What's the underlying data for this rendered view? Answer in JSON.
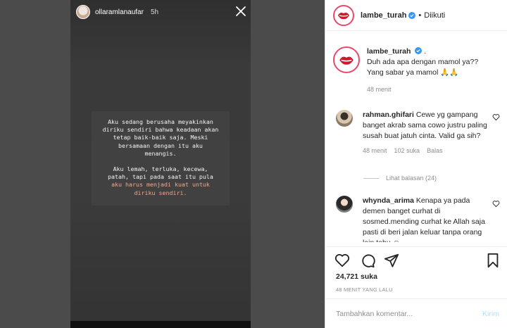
{
  "story": {
    "username": "ollaramlanaufar",
    "time": "5h",
    "text_lines": [
      "Aku sedang berusaha meyakinkan",
      "diriku sendiri bahwa keadaan akan",
      "tetap baik-baik saja. Meski",
      "bersamaan dengan itu aku",
      "menangis."
    ],
    "text_lines_2": [
      "Aku lemah, terluka, kecewa,",
      "patah, tapi pada saat itu pula"
    ],
    "highlight_lines": [
      "aku harus menjadi kuat untuk",
      "diriku sendiri."
    ],
    "highlight_color": "#f0a88e"
  },
  "post": {
    "header": {
      "username": "lambe_turah",
      "separator": "•",
      "follow_status": "Diikuti"
    },
    "caption": {
      "username": "lambe_turah",
      "suffix": ".",
      "line1": "Duh ada apa dengan mamol ya??",
      "line2": "Yang sabar ya mamol 🙏🙏",
      "time": "48 menit"
    },
    "comments": [
      {
        "username": "rahman.ghifari",
        "text": "Cewe yg gampang banget akrab sama cowo justru paling susah buat jatuh cinta. Valid ga sih?",
        "time": "48 menit",
        "likes": "102 suka",
        "reply": "Balas",
        "view_replies": "Lihat balasan (24)"
      },
      {
        "username": "whynda_arima",
        "text": "Kenapa ya pada demen banget curhat di sosmed.mending curhat ke Allah saja pasti di beri jalan keluar tanpa orang lain tahu ☺"
      }
    ],
    "likes": "24,721 suka",
    "posted_ago": "48 MENIT YANG LALU",
    "comment_placeholder": "Tambahkan komentar...",
    "post_button": "Kirim",
    "colors": {
      "brand_ring": "#e84b6a",
      "verified": "#3897f0",
      "post_button_disabled": "#b2dffc"
    }
  }
}
